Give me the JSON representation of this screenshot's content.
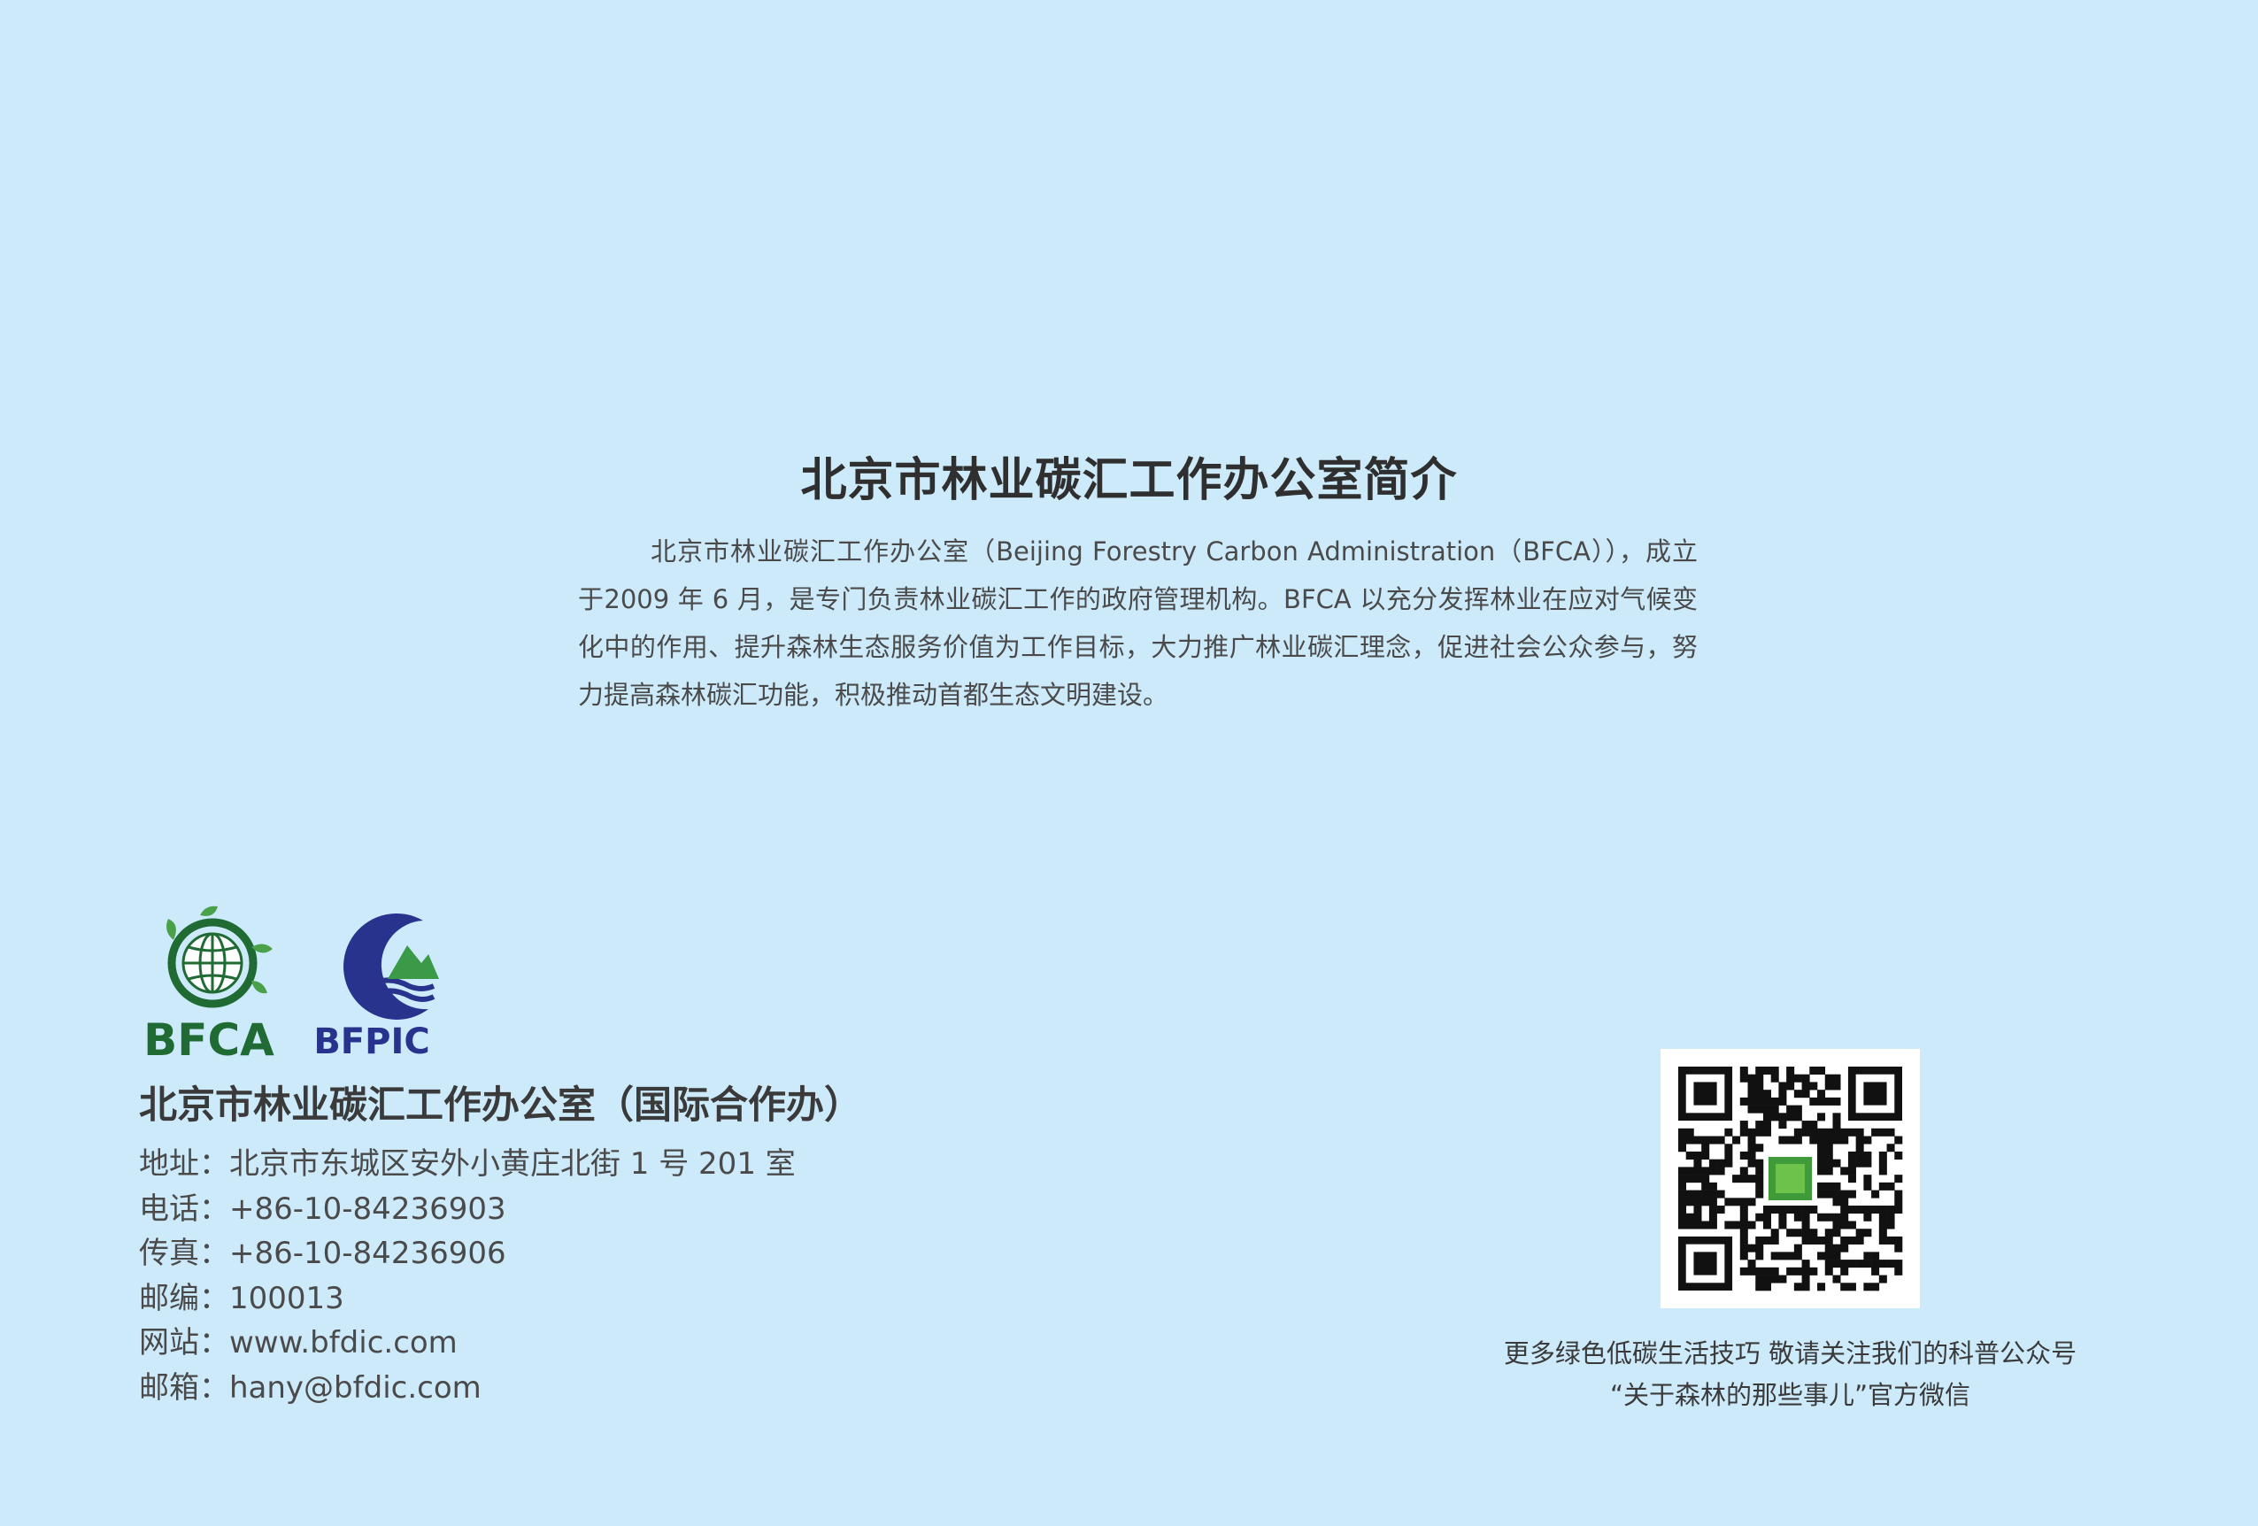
{
  "intro": {
    "title": "北京市林业碳汇工作办公室简介",
    "body": "北京市林业碳汇工作办公室（Beijing Forestry Carbon Administration（BFCA）），成立于2009 年 6 月，是专门负责林业碳汇工作的政府管理机构。BFCA 以充分发挥林业在应对气候变化中的作用、提升森林生态服务价值为工作目标，大力推广林业碳汇理念，促进社会公众参与，努力提高森林碳汇功能，积极推动首都生态文明建设。"
  },
  "logos": {
    "bfca": {
      "text": "BFCA",
      "color": "#1f6b33"
    },
    "bfpic": {
      "text": "BFPIC",
      "color": "#28338e"
    }
  },
  "contact": {
    "org_name": "北京市林业碳汇工作办公室（国际合作办）",
    "lines": [
      {
        "label": "地址：",
        "value": "北京市东城区安外小黄庄北街 1 号 201 室"
      },
      {
        "label": "电话：",
        "value": "+86-10-84236903"
      },
      {
        "label": "传真：",
        "value": "+86-10-84236906"
      },
      {
        "label": "邮编：",
        "value": "100013"
      },
      {
        "label": "网站：",
        "value": "www.bfdic.com"
      },
      {
        "label": "邮箱：",
        "value": "hany@bfdic.com"
      }
    ]
  },
  "qr": {
    "caption_line1": "更多绿色低碳生活技巧  敬请关注我们的科普公众号",
    "caption_line2": "“关于森林的那些事儿”官方微信"
  },
  "colors": {
    "background": "#cdeafb",
    "bfca_green": "#1f6b33",
    "bfpic_blue": "#28338e",
    "mountain_green": "#3a9a48"
  }
}
